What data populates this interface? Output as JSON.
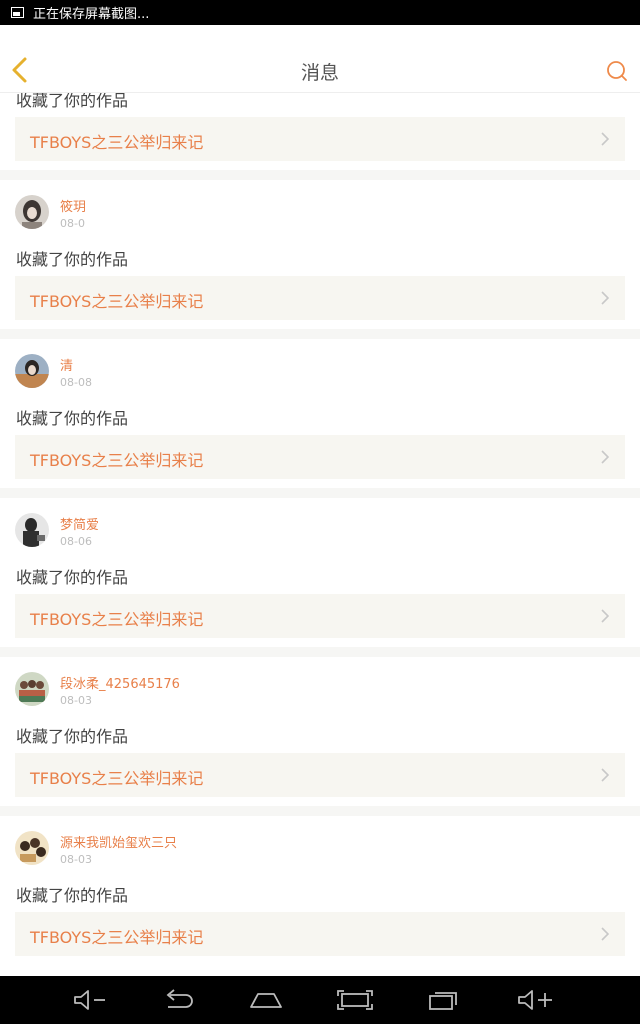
{
  "status_bar": {
    "notification_text": "正在保存屏幕截图..."
  },
  "header": {
    "title": "消息"
  },
  "partial_item": {
    "action": "收藏了你的作品",
    "work_title": "TFBOYS之三公举归来记"
  },
  "items": [
    {
      "username": "筱玥",
      "date": "08-0",
      "action": "收藏了你的作品",
      "work_title": "TFBOYS之三公举归来记"
    },
    {
      "username": "清",
      "date": "08-08",
      "action": "收藏了你的作品",
      "work_title": "TFBOYS之三公举归来记"
    },
    {
      "username": "梦简爱",
      "date": "08-06",
      "action": "收藏了你的作品",
      "work_title": "TFBOYS之三公举归来记"
    },
    {
      "username": "段冰柔_425645176",
      "date": "08-03",
      "action": "收藏了你的作品",
      "work_title": "TFBOYS之三公举归来记"
    },
    {
      "username": "源来我凯始玺欢三只",
      "date": "08-03",
      "action": "收藏了你的作品",
      "work_title": "TFBOYS之三公举归来记"
    }
  ],
  "colors": {
    "accent": "#e8804a",
    "link_bg": "#f7f6f1",
    "back_icon": "#e6b12e"
  }
}
